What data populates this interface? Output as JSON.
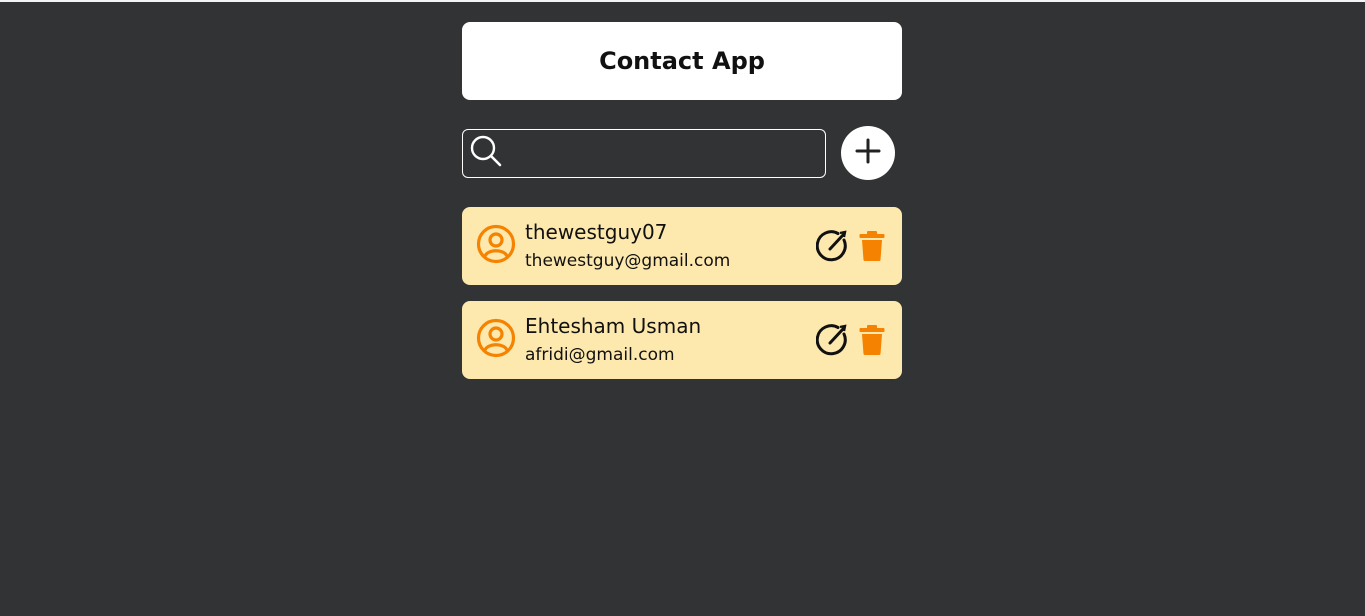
{
  "header": {
    "title": "Contact App"
  },
  "search": {
    "placeholder": "",
    "value": ""
  },
  "contacts": [
    {
      "name": "thewestguy07",
      "email": "thewestguy@gmail.com"
    },
    {
      "name": "Ehtesham Usman",
      "email": "afridi@gmail.com"
    }
  ],
  "colors": {
    "background": "#323334",
    "card": "#fde9ad",
    "accent": "#f58200",
    "header_bg": "#ffffff"
  },
  "icons": {
    "search": "search-icon",
    "add": "plus-icon",
    "avatar": "user-circle-icon",
    "edit": "edit-icon",
    "delete": "trash-icon"
  }
}
